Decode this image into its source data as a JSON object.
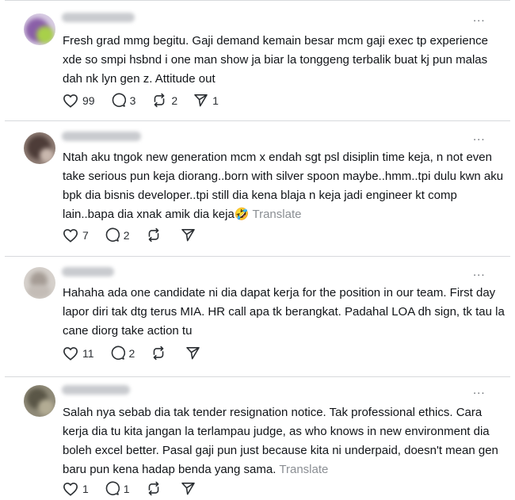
{
  "more_label": "...",
  "posts": [
    {
      "text": "Fresh grad mmg begitu. Gaji demand kemain besar mcm gaji exec tp experience xde so smpi hsbnd i one man show ja biar la tonggeng terbalik buat kj pun malas dah nk lyn gen z. Attitude out",
      "translate": "",
      "likes": "99",
      "replies": "3",
      "reposts": "2",
      "shares": "1",
      "avatar_color": "#8a5fa8"
    },
    {
      "text": "Ntah aku tngok new generation mcm x endah sgt psl disiplin time keja, n not even take serious pun keja diorang..born with silver spoon maybe..hmm..tpi dulu kwn aku bpk dia bisnis developer..tpi still dia kena blaja n keja jadi engineer kt comp lain..bapa dia xnak amik dia keja🤣",
      "translate": "Translate",
      "likes": "7",
      "replies": "2",
      "reposts": "",
      "shares": "",
      "avatar_color": "#5a4a46"
    },
    {
      "text": "Hahaha ada one candidate ni dia dapat kerja for the position in our team. First day lapor diri tak dtg terus MIA. HR call apa tk berangkat. Padahal LOA dh sign, tk tau la cane diorg take action tu",
      "translate": "",
      "likes": "11",
      "replies": "2",
      "reposts": "",
      "shares": "",
      "avatar_color": "#b7aea8"
    },
    {
      "text": "Salah nya sebab dia tak tender resignation notice. Tak professional ethics. Cara kerja dia tu kita jangan la terlampau judge, as who knows in new environment dia boleh excel better. Pasal gaji pun just because kita ni underpaid, doesn't mean gen baru pun kena hadap benda yang sama.",
      "translate": "Translate",
      "likes": "1",
      "replies": "1",
      "reposts": "",
      "shares": "",
      "avatar_color": "#6f6b5c"
    }
  ]
}
